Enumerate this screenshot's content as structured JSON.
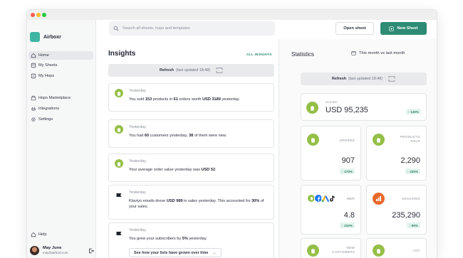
{
  "app": {
    "name": "Airboxr"
  },
  "sidebar": {
    "items": [
      {
        "label": "Home",
        "icon": "home-icon",
        "active": true
      },
      {
        "label": "My Sheets",
        "icon": "sheet-icon"
      },
      {
        "label": "My Hops",
        "icon": "hops-icon"
      },
      {
        "label": "Hops Marketplace",
        "icon": "marketplace-icon"
      },
      {
        "label": "Integrations",
        "icon": "integrations-icon"
      },
      {
        "label": "Settings",
        "icon": "settings-icon"
      }
    ],
    "help": "Help",
    "user": {
      "name": "May June",
      "email": "may@airboxr.com"
    }
  },
  "topbar": {
    "search_placeholder": "Search all sheets, hops and templates",
    "open_sheet": "Open sheet",
    "new_sheet": "New Sheet"
  },
  "insights": {
    "title": "Insights",
    "all_link": "ALL INSIGHTS",
    "refresh": {
      "label": "Refresh",
      "meta": "(last updated 18:48)"
    },
    "cards": [
      {
        "day": "Yesterday",
        "source": "shopify",
        "parts": [
          [
            "You sold ",
            false
          ],
          [
            "153",
            true
          ],
          [
            " products in ",
            false
          ],
          [
            "61",
            true
          ],
          [
            " orders worth ",
            false
          ],
          [
            "USD 3189",
            true
          ],
          [
            " yesterday.",
            false
          ]
        ]
      },
      {
        "day": "Yesterday",
        "source": "shopify",
        "parts": [
          [
            "You had ",
            false
          ],
          [
            "60",
            true
          ],
          [
            " customers yesterday, ",
            false
          ],
          [
            "38",
            true
          ],
          [
            " of them were new.",
            false
          ]
        ]
      },
      {
        "day": "Yesterday",
        "source": "shopify",
        "parts": [
          [
            "Your average order value yesterday was ",
            false
          ],
          [
            "USD 52",
            true
          ],
          [
            ".",
            false
          ]
        ]
      },
      {
        "day": "Yesterday",
        "source": "klaviyo",
        "parts": [
          [
            "Klaviyo emails drove ",
            false
          ],
          [
            "USD 989",
            true
          ],
          [
            " in sales yesterday. This accounted for ",
            false
          ],
          [
            "30%",
            true
          ],
          [
            " of your sales.",
            false
          ]
        ]
      },
      {
        "day": "Yesterday",
        "source": "klaviyo",
        "parts": [
          [
            "You grew your subscribers by ",
            false
          ],
          [
            "5%",
            true
          ],
          [
            " yesterday.",
            false
          ]
        ],
        "link": "See how your lists have grown over time",
        "link_arrow": "→"
      }
    ]
  },
  "statistics": {
    "title": "Statistics",
    "period": "This month vs last month",
    "refresh": {
      "label": "Refresh",
      "meta": "(last updated 18:48)"
    },
    "sales": {
      "label": "SALES",
      "value": "USD 95,235",
      "change": "↑ 140%"
    },
    "orders": {
      "label": "ORDERS",
      "value": "907",
      "change": "↑ 170%"
    },
    "products_sold": {
      "label": "PRODUCTS SOLD",
      "value": "2,290",
      "change": "↑ 230%"
    },
    "mer": {
      "label": "MER",
      "value": "4.8",
      "change": "↑ 210%",
      "logos": [
        "shopify",
        "facebook",
        "google-ads",
        "tiktok"
      ]
    },
    "sessions": {
      "label": "SESSIONS",
      "value": "235,290",
      "change": "↑ 80%"
    },
    "new_customers": {
      "label": "NEW CUSTOMERS"
    },
    "aov": {
      "label": "AOV"
    }
  },
  "colors": {
    "accent": "#2e8b74",
    "shopify": "#95bf47",
    "badge_bg": "#e3f4ee",
    "badge_text": "#2a7d63",
    "logo": "#3fb6a3",
    "sessions": "#e8692c"
  }
}
